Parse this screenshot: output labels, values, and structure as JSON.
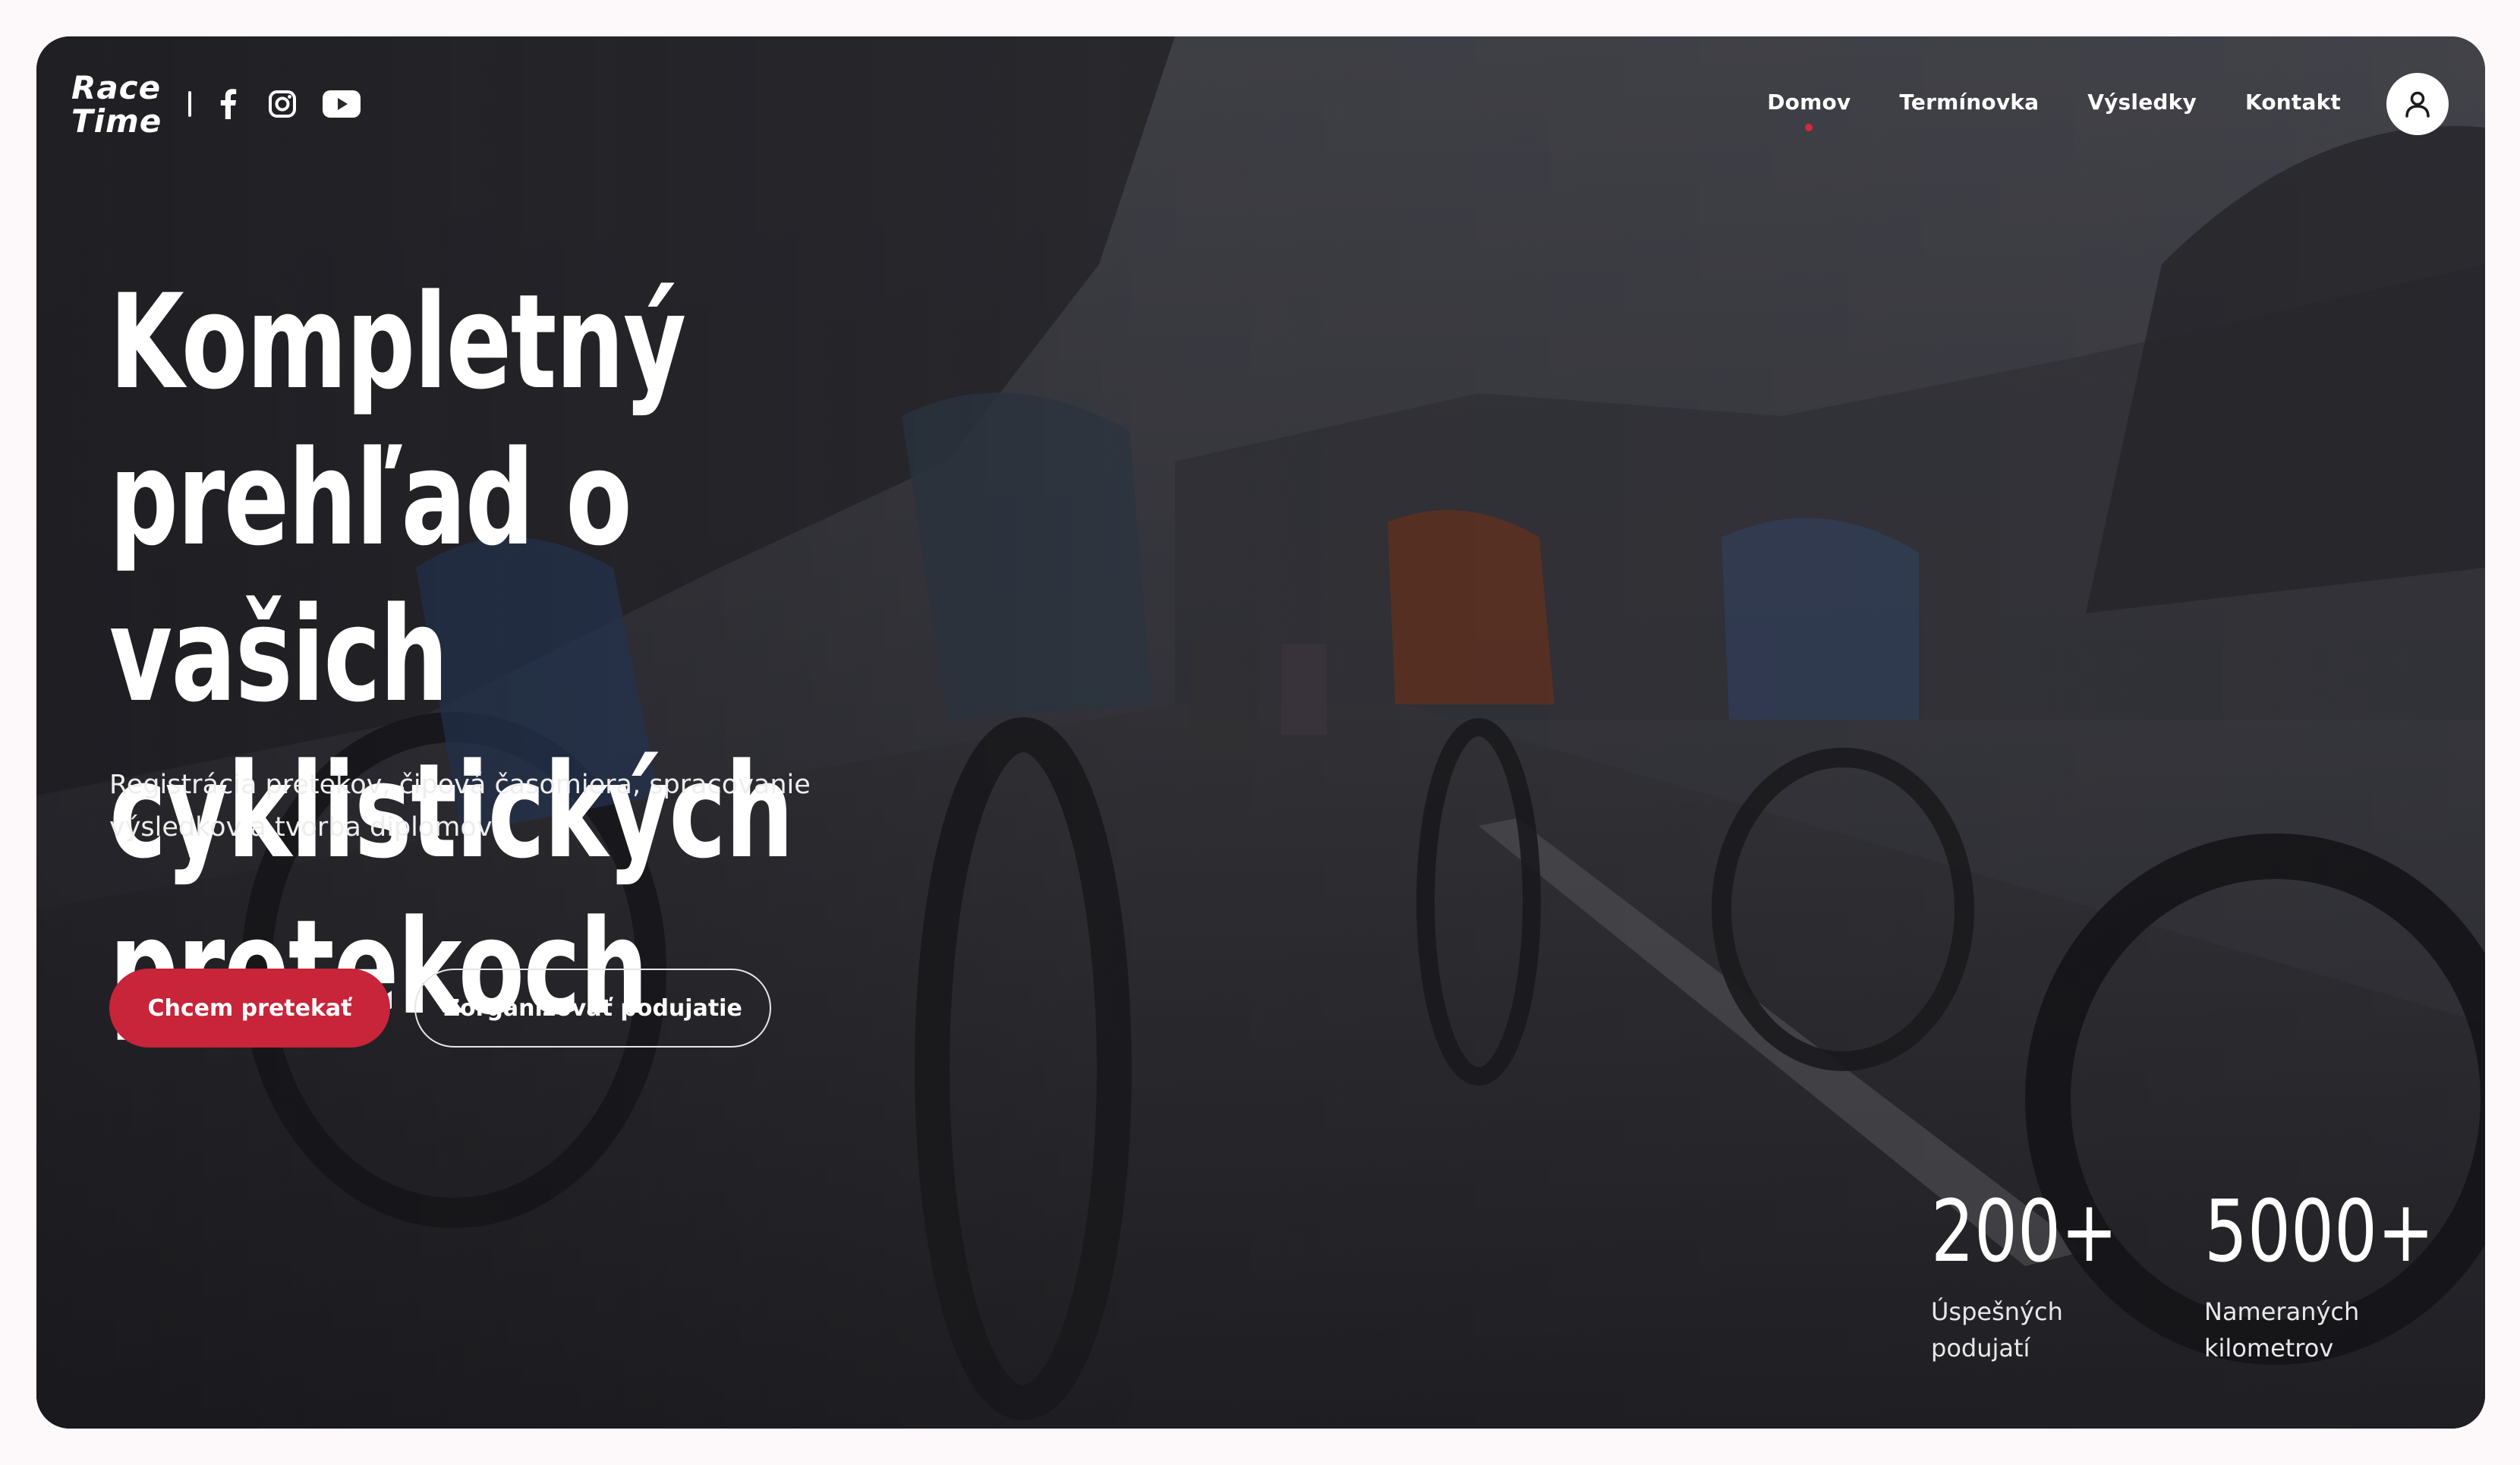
{
  "brand": {
    "logo_line1": "Race",
    "logo_line2": "Time"
  },
  "social": [
    {
      "name": "facebook-icon"
    },
    {
      "name": "instagram-icon"
    },
    {
      "name": "youtube-icon"
    }
  ],
  "nav": {
    "items": [
      {
        "label": "Domov",
        "active": true
      },
      {
        "label": "Termínovka",
        "active": false
      },
      {
        "label": "Výsledky",
        "active": false
      },
      {
        "label": "Kontakt",
        "active": false
      }
    ],
    "user_icon": "user-icon"
  },
  "hero": {
    "title": "Kompletný prehľad o vašich cyklistických pretekoch",
    "subtitle": "Registrácia pretekov, čipová časomiera, spracovanie výsledkov a tvorba diplomov",
    "primary_button": "Chcem pretekať",
    "secondary_button": "Zorganizovať podujatie"
  },
  "stats": [
    {
      "value": "200+",
      "label": "Úspešných podujatí"
    },
    {
      "value": "5000+",
      "label": "Nameraných kilometrov"
    }
  ],
  "colors": {
    "accent": "#c8243a",
    "active_dot": "#d7263d",
    "page_background": "#fdf9fa"
  }
}
